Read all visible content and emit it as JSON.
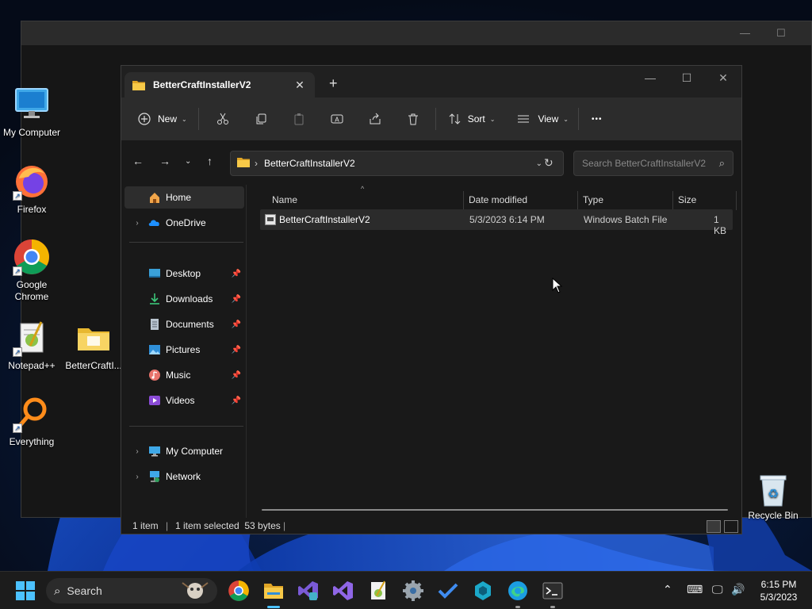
{
  "desktop": {
    "icons": [
      {
        "label": "My Computer"
      },
      {
        "label": "Firefox"
      },
      {
        "label": "Google Chrome"
      },
      {
        "label": "Notepad++"
      },
      {
        "label": "BetterCraftI..."
      },
      {
        "label": "Everything"
      },
      {
        "label": "Recycle Bin"
      }
    ]
  },
  "explorer": {
    "tab_title": "BetterCraftInstallerV2",
    "new_tab_glyph": "+",
    "toolbar": {
      "new_label": "New",
      "sort_label": "Sort",
      "view_label": "View",
      "more_glyph": "•••"
    },
    "address": {
      "path": "BetterCraftInstallerV2",
      "search_placeholder": "Search BetterCraftInstallerV2"
    },
    "nav": {
      "home": "Home",
      "onedrive": "OneDrive",
      "quick": [
        "Desktop",
        "Downloads",
        "Documents",
        "Pictures",
        "Music",
        "Videos"
      ],
      "my_computer": "My Computer",
      "network": "Network"
    },
    "columns": {
      "name": "Name",
      "date": "Date modified",
      "type": "Type",
      "size": "Size"
    },
    "files": [
      {
        "name": "BetterCraftInstallerV2",
        "date": "5/3/2023 6:14 PM",
        "type": "Windows Batch File",
        "size": "1 KB"
      }
    ],
    "status": {
      "count": "1 item",
      "selection": "1 item selected  53 bytes"
    }
  },
  "taskbar": {
    "search_label": "Search",
    "time": "6:15 PM",
    "date": "5/3/2023"
  },
  "colors": {
    "accent": "#4cc2ff",
    "folder_yellow": "#f3c84a"
  }
}
